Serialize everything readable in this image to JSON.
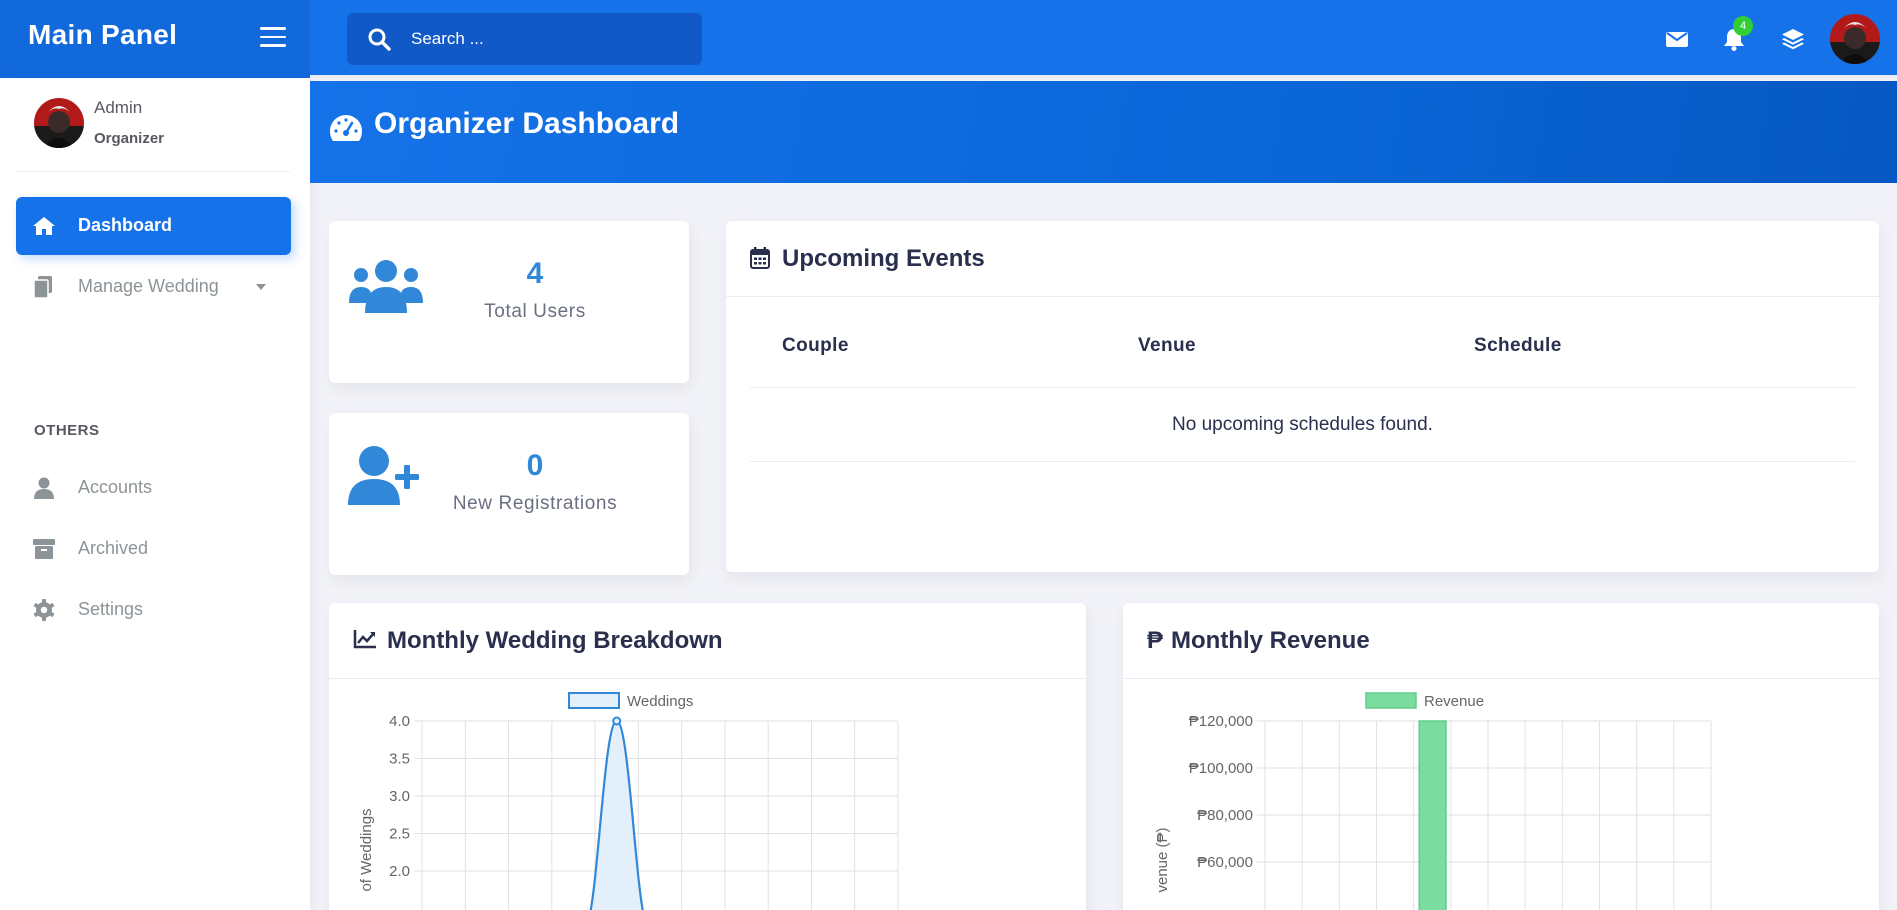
{
  "brand": {
    "title": "Main Panel"
  },
  "search": {
    "placeholder": "Search ..."
  },
  "topnav": {
    "notification_count": "4"
  },
  "sidebar": {
    "user_name": "Admin",
    "user_role": "Organizer",
    "items": [
      {
        "label": "Dashboard",
        "icon": "home-icon",
        "active": true
      },
      {
        "label": "Manage Wedding",
        "icon": "file-icon"
      },
      {
        "label": "Accounts",
        "icon": "user-icon"
      },
      {
        "label": "Archived",
        "icon": "archive-icon"
      },
      {
        "label": "Settings",
        "icon": "gear-icon"
      }
    ],
    "section_others": "OTHERS"
  },
  "header": {
    "title": "Organizer Dashboard"
  },
  "stats": [
    {
      "value": "4",
      "label": "Total Users"
    },
    {
      "value": "0",
      "label": "New Registrations"
    }
  ],
  "events": {
    "title": "Upcoming Events",
    "columns": [
      "Couple",
      "Venue",
      "Schedule"
    ],
    "empty_message": "No upcoming schedules found."
  },
  "colors": {
    "primary": "#1572e8",
    "accent_blue": "#3288d8",
    "success": "#31ce36",
    "revenue_green": "#7bdca0"
  },
  "chart_data": [
    {
      "type": "area",
      "title": "Monthly Wedding Breakdown",
      "legend": [
        "Weddings"
      ],
      "ylabel": "of Weddings",
      "yticks": [
        "4.0",
        "3.5",
        "3.0",
        "2.5",
        "2.0"
      ],
      "ylim": [
        2.0,
        4.0
      ],
      "x_slots": 11,
      "series": [
        {
          "name": "Weddings",
          "values": [
            0,
            0,
            0,
            0,
            4,
            0,
            0,
            0,
            0,
            0,
            0,
            0
          ]
        }
      ]
    },
    {
      "type": "bar",
      "title": "Monthly Revenue",
      "currency_symbol": "₱",
      "legend": [
        "Revenue"
      ],
      "ylabel": "venue (₱)",
      "yticks": [
        "₱120,000",
        "₱100,000",
        "₱80,000",
        "₱60,000"
      ],
      "ylim": [
        60000,
        120000
      ],
      "x_slots": 12,
      "series": [
        {
          "name": "Revenue",
          "values": [
            0,
            0,
            0,
            0,
            120000,
            0,
            0,
            0,
            0,
            0,
            0,
            0
          ]
        }
      ]
    }
  ]
}
